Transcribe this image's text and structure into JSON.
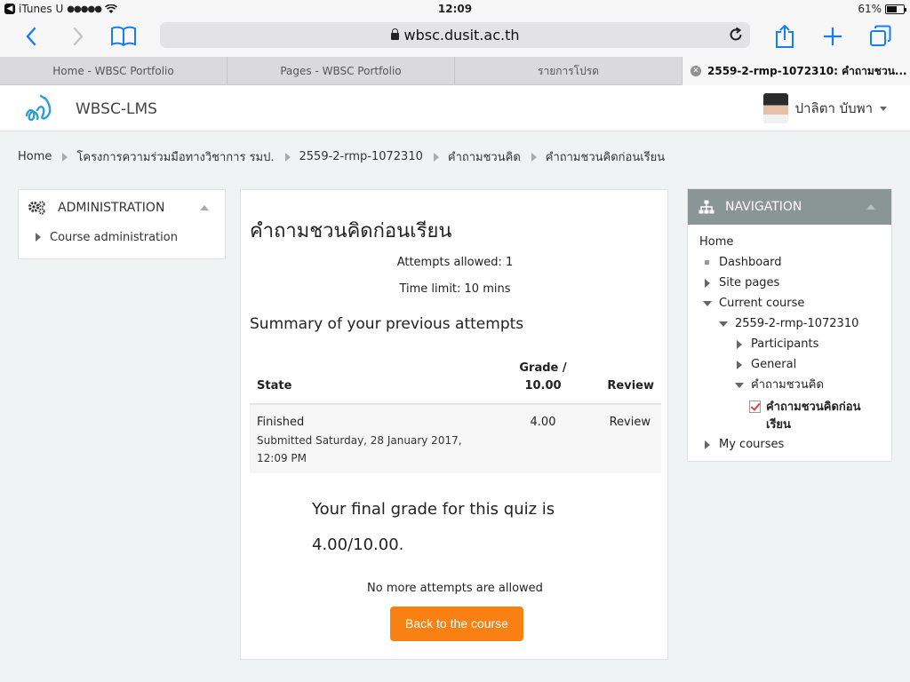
{
  "status_bar": {
    "back_app": "iTunes U",
    "signal": "●●●●●",
    "time": "12:09",
    "battery_text": "61%",
    "battery_level": 0.61
  },
  "browser": {
    "url": "wbsc.dusit.ac.th",
    "tabs": [
      {
        "label": "Home - WBSC Portfolio"
      },
      {
        "label": "Pages - WBSC Portfolio"
      },
      {
        "label": "รายการโปรด"
      },
      {
        "label": "2559-2-rmp-1072310: คำถามชวน..."
      }
    ]
  },
  "header": {
    "site_name": "WBSC-LMS",
    "user_name": "ปาลิตา บับพา"
  },
  "breadcrumb": [
    "Home",
    "โครงการความร่วมมือทางวิชาการ รมป.",
    "2559-2-rmp-1072310",
    "คำถามชวนคิด",
    "คำถามชวนคิดก่อนเรียน"
  ],
  "admin_block": {
    "title": "ADMINISTRATION",
    "items": [
      "Course administration"
    ]
  },
  "navigation": {
    "title": "NAVIGATION",
    "home": "Home",
    "dashboard": "Dashboard",
    "site_pages": "Site pages",
    "current_course": "Current course",
    "course_code": "2559-2-rmp-1072310",
    "participants": "Participants",
    "general": "General",
    "section": "คำถามชวนคิด",
    "quiz_line1": "คำถามชวนคิดก่อน",
    "quiz_line2": "เรียน",
    "my_courses": "My courses"
  },
  "quiz": {
    "title": "คำถามชวนคิดก่อนเรียน",
    "attempts_allowed": "Attempts allowed: 1",
    "time_limit": "Time limit: 10 mins",
    "summary_title": "Summary of your previous attempts",
    "columns": {
      "state": "State",
      "grade_line1": "Grade /",
      "grade_line2": "10.00",
      "review": "Review"
    },
    "attempt": {
      "state": "Finished",
      "submitted": "Submitted Saturday, 28 January 2017, 12:09 PM",
      "grade": "4.00",
      "review": "Review"
    },
    "final_grade_line1": "Your final grade for this quiz is",
    "final_grade_line2": "4.00/10.00.",
    "no_more": "No more attempts are allowed",
    "back_button": "Back to the course"
  },
  "colors": {
    "accent": "#f98012",
    "nav_header": "#8a9696",
    "page_bg": "#f0f3f3",
    "ios_blue": "#147efb"
  }
}
